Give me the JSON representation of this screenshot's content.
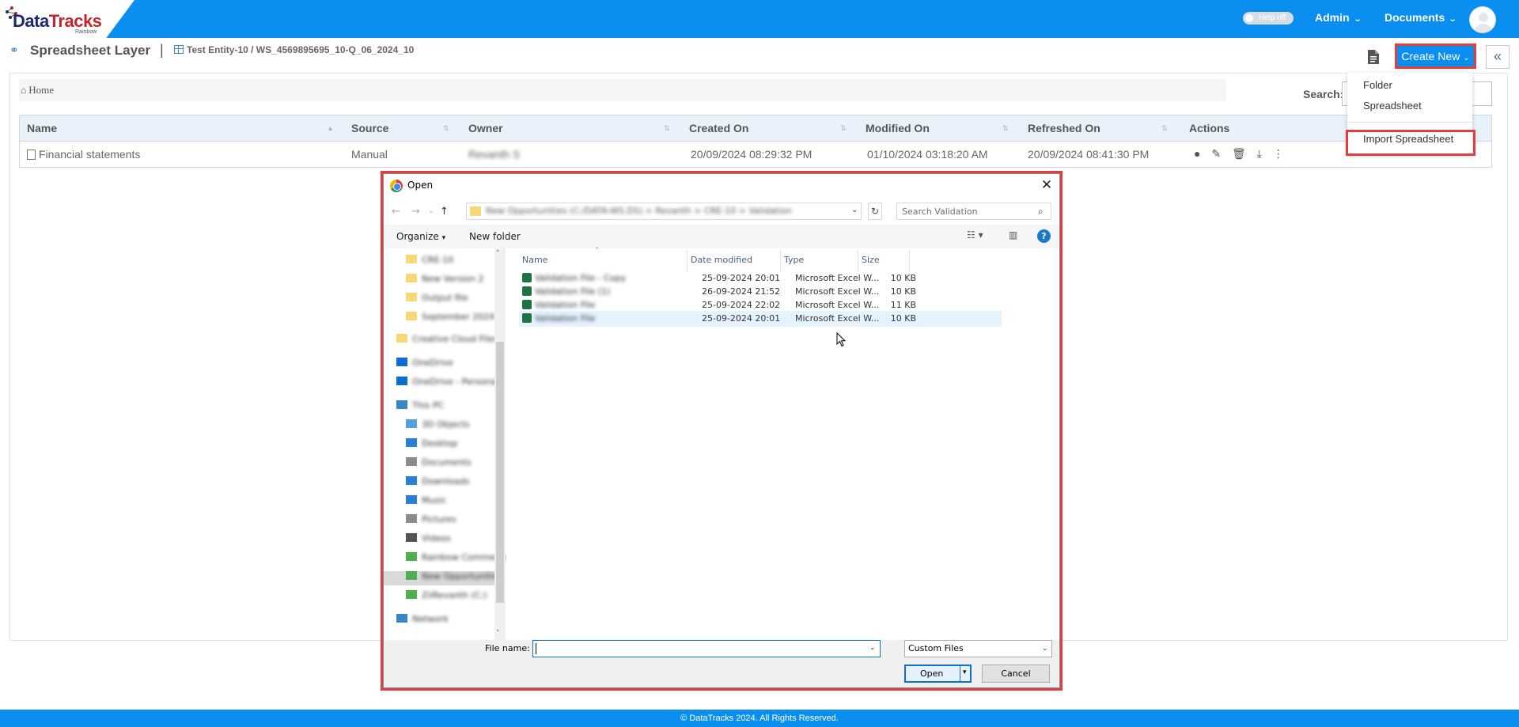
{
  "header": {
    "logo_brand_1": "Data",
    "logo_brand_2": "Tracks",
    "logo_sub": "Rainbow",
    "help_toggle": "Help off",
    "admin_label": "Admin",
    "documents_label": "Documents"
  },
  "page": {
    "title": "Spreadsheet Layer",
    "separator": "|",
    "entity_path": "Test Entity-10 / WS_4569895695_10-Q_06_2024_10",
    "create_new": "Create New",
    "breadcrumb_home": "Home",
    "search_label": "Search:"
  },
  "create_menu": {
    "items": [
      "Folder",
      "Spreadsheet",
      "Import Spreadsheet"
    ]
  },
  "table": {
    "headers": [
      "Name",
      "Source",
      "Owner",
      "Created On",
      "Modified On",
      "Refreshed On",
      "Actions"
    ],
    "rows": [
      {
        "name": "Financial statements",
        "source": "Manual",
        "owner": "Revanth S",
        "created": "20/09/2024 08:29:32 PM",
        "modified": "01/10/2024 03:18:20 AM",
        "refreshed": "20/09/2024 08:41:30 PM"
      }
    ]
  },
  "dialog": {
    "title": "Open",
    "address": "New Opportunities (C:/DATA-WS.DS) > Revanth > CRE-10 > Validation",
    "search_placeholder": "Search Validation",
    "organize": "Organize",
    "new_folder": "New folder",
    "columns": [
      "Name",
      "Date modified",
      "Type",
      "Size"
    ],
    "nav_items": [
      {
        "label": "CRE-10",
        "icon": "folder-icon"
      },
      {
        "label": "New Version 2",
        "icon": "folder-icon"
      },
      {
        "label": "Output file",
        "icon": "folder-icon"
      },
      {
        "label": "September 2024",
        "icon": "folder-icon"
      },
      {
        "label": "Creative Cloud Files",
        "icon": "folder-icon"
      },
      {
        "label": "OneDrive",
        "icon": "cloud-icon"
      },
      {
        "label": "OneDrive - Personal",
        "icon": "cloud-icon"
      },
      {
        "label": "This PC",
        "icon": "pc-icon"
      },
      {
        "label": "3D Objects",
        "icon": "cube-icon"
      },
      {
        "label": "Desktop",
        "icon": "desktop-icon"
      },
      {
        "label": "Documents",
        "icon": "documents-icon"
      },
      {
        "label": "Downloads",
        "icon": "download-icon"
      },
      {
        "label": "Music",
        "icon": "music-icon"
      },
      {
        "label": "Pictures",
        "icon": "pictures-icon"
      },
      {
        "label": "Videos",
        "icon": "video-icon"
      },
      {
        "label": "Rainbow Comments",
        "icon": "drive-icon"
      },
      {
        "label": "New Opportunities",
        "icon": "drive-icon"
      },
      {
        "label": "ZiiRevanth (C:)",
        "icon": "drive-icon"
      },
      {
        "label": "Network",
        "icon": "network-icon"
      }
    ],
    "files": [
      {
        "name": "Validation File - Copy",
        "date": "25-09-2024 20:01",
        "type": "Microsoft Excel W...",
        "size": "10 KB"
      },
      {
        "name": "Validation File (1)",
        "date": "26-09-2024 21:52",
        "type": "Microsoft Excel W...",
        "size": "10 KB"
      },
      {
        "name": "Validation File",
        "date": "25-09-2024 22:02",
        "type": "Microsoft Excel W...",
        "size": "11 KB"
      },
      {
        "name": "Validation File",
        "date": "25-09-2024 20:01",
        "type": "Microsoft Excel W...",
        "size": "10 KB"
      }
    ],
    "file_name_label": "File name:",
    "file_name_value": "",
    "filter": "Custom Files",
    "open": "Open",
    "cancel": "Cancel"
  },
  "footer": {
    "text": "© DataTracks 2024. All Rights Reserved."
  },
  "colors": {
    "brand_blue": "#0a8ff0",
    "highlight_red": "#e53c3c"
  }
}
